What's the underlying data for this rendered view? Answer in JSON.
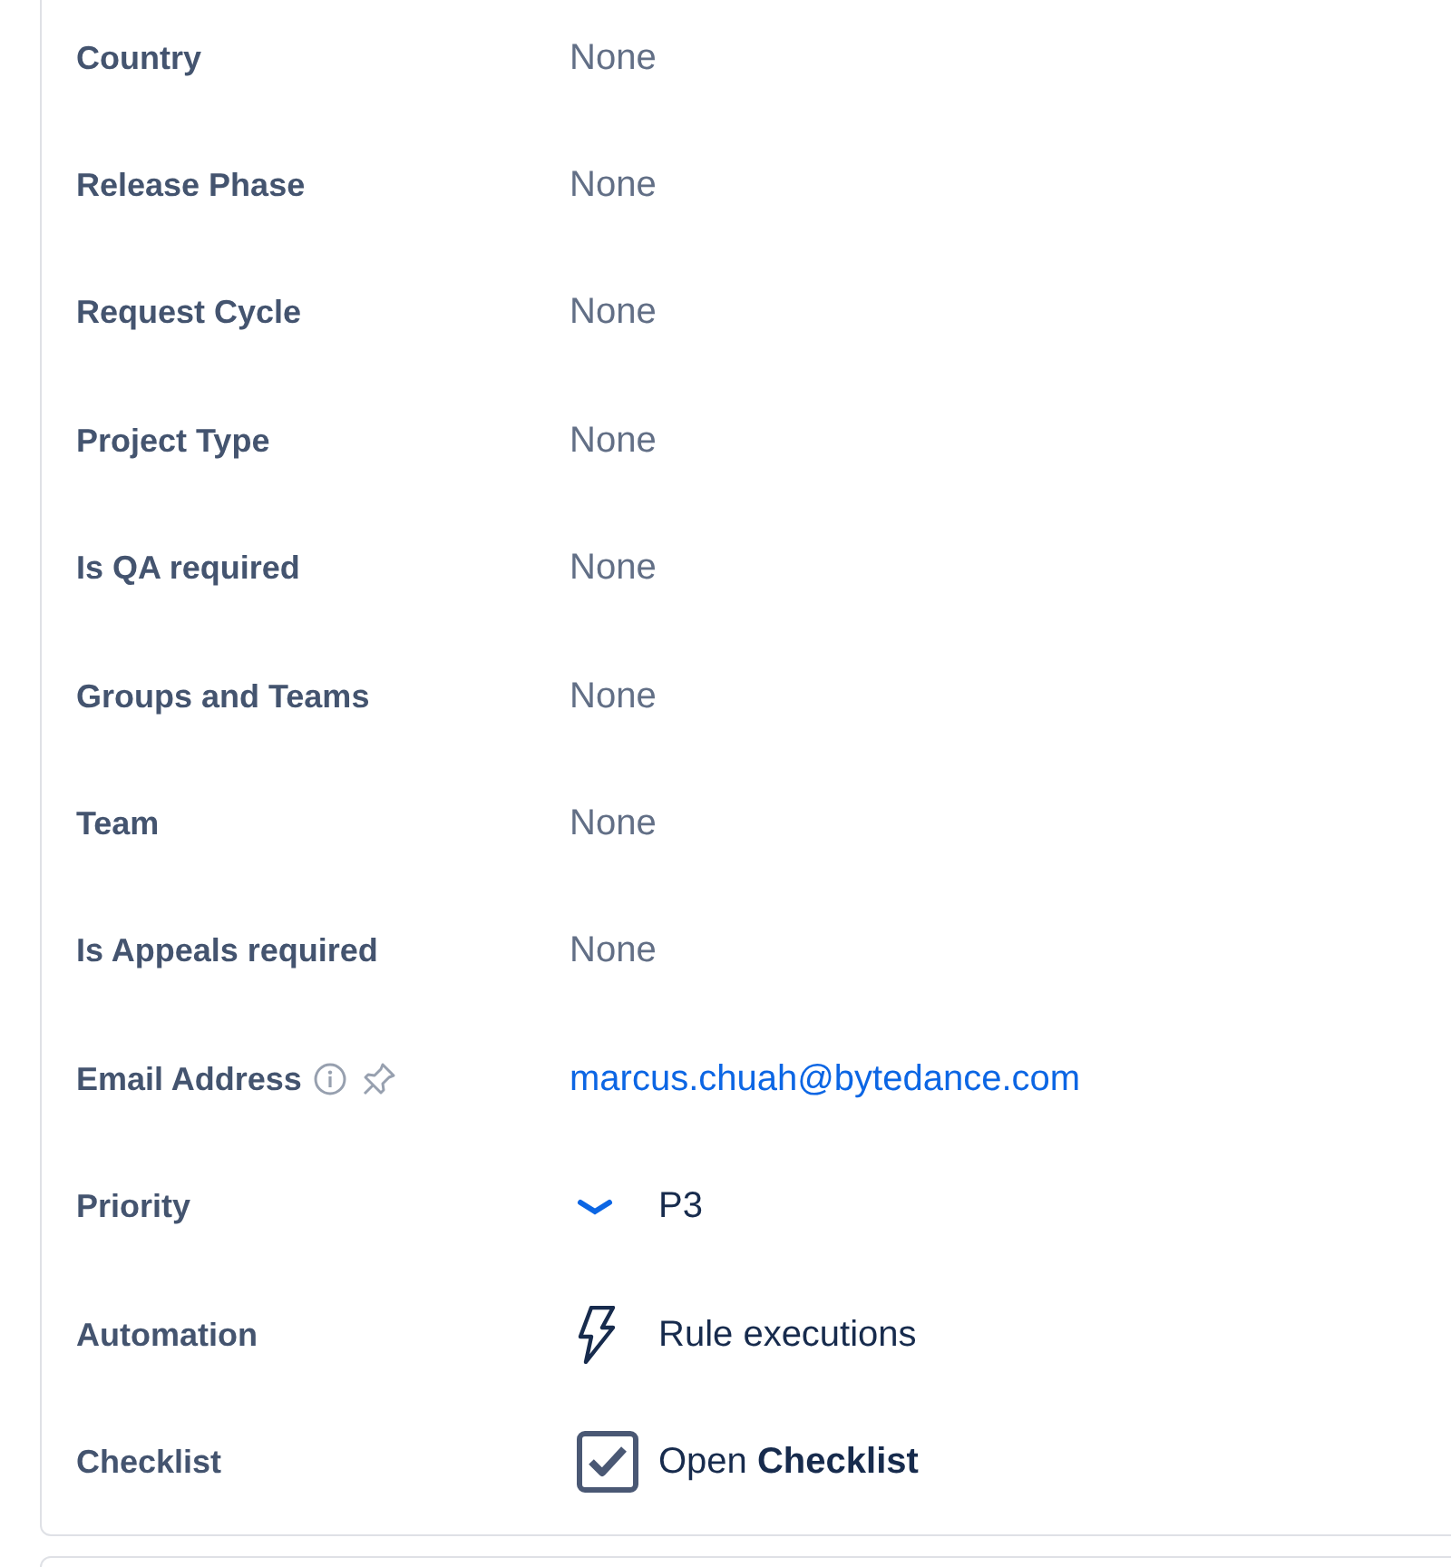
{
  "fields": [
    {
      "kind": "text",
      "label": "Country",
      "value": "None"
    },
    {
      "kind": "text",
      "label": "Release Phase",
      "value": "None"
    },
    {
      "kind": "text",
      "label": "Request Cycle",
      "value": "None"
    },
    {
      "kind": "text",
      "label": "Project Type",
      "value": "None"
    },
    {
      "kind": "text",
      "label": "Is QA required",
      "value": "None"
    },
    {
      "kind": "text",
      "label": "Groups and Teams",
      "value": "None"
    },
    {
      "kind": "text",
      "label": "Team",
      "value": "None"
    },
    {
      "kind": "text",
      "label": "Is Appeals required",
      "value": "None"
    },
    {
      "kind": "email",
      "label": "Email Address",
      "value": "marcus.chuah@bytedance.com"
    },
    {
      "kind": "priority",
      "label": "Priority",
      "value": "P3"
    },
    {
      "kind": "automation",
      "label": "Automation",
      "value": "Rule executions"
    },
    {
      "kind": "checklist",
      "label": "Checklist",
      "value": "Open **Checklist**"
    }
  ]
}
